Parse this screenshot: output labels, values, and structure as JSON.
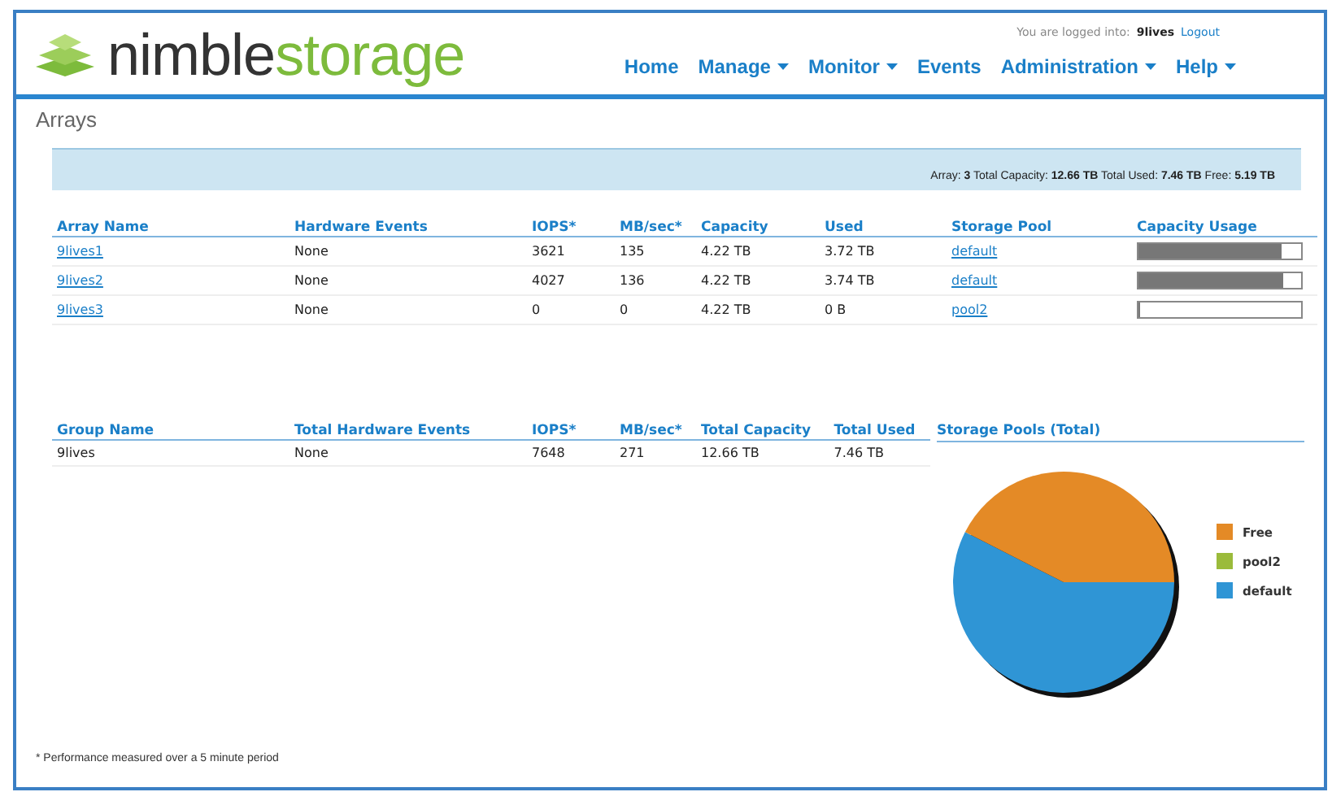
{
  "header": {
    "logo": {
      "primary": "nimble",
      "secondary": "storage"
    },
    "login": {
      "prefix": "You are logged into:",
      "group": "9lives",
      "logout": "Logout"
    },
    "nav": [
      {
        "label": "Home",
        "has_menu": false
      },
      {
        "label": "Manage",
        "has_menu": true
      },
      {
        "label": "Monitor",
        "has_menu": true
      },
      {
        "label": "Events",
        "has_menu": false
      },
      {
        "label": "Administration",
        "has_menu": true
      },
      {
        "label": "Help",
        "has_menu": true
      }
    ]
  },
  "page_title": "Arrays",
  "summary": "Array: **3** Total Capacity: **12.66 TB** Total Used: **7.46 TB** Free: **5.19 TB**",
  "arrays_table": {
    "columns": [
      "Array Name",
      "Hardware Events",
      "IOPS*",
      "MB/sec*",
      "Capacity",
      "Used",
      "Storage Pool",
      "Capacity Usage"
    ],
    "rows": [
      {
        "name": "9lives1",
        "events": "None",
        "iops": "3621",
        "mbsec": "135",
        "capacity": "4.22 TB",
        "used": "3.72 TB",
        "pool": "default",
        "level": 0.88
      },
      {
        "name": "9lives2",
        "events": "None",
        "iops": "4027",
        "mbsec": "136",
        "capacity": "4.22 TB",
        "used": "3.74 TB",
        "pool": "default",
        "level": 0.89
      },
      {
        "name": "9lives3",
        "events": "None",
        "iops": "0",
        "mbsec": "0",
        "capacity": "4.22 TB",
        "used": "0 B",
        "pool": "pool2",
        "level": 0
      }
    ]
  },
  "group_table": {
    "columns": [
      "Group Name",
      "Total Hardware Events",
      "IOPS*",
      "MB/sec*",
      "Total Capacity",
      "Total Used"
    ],
    "rows": [
      {
        "cells": [
          "9lives",
          "None",
          "7648",
          "271",
          "12.66 TB",
          "7.46 TB"
        ]
      }
    ]
  },
  "storage_pools": {
    "title": "Storage Pools (Total)",
    "legend": [
      {
        "label": "Free",
        "color": "#e48a26"
      },
      {
        "label": "pool2",
        "color": "#9bbb3b"
      },
      {
        "label": "default",
        "color": "#2f95d5"
      }
    ]
  },
  "footnote": "* Performance measured over a 5 minute period"
}
